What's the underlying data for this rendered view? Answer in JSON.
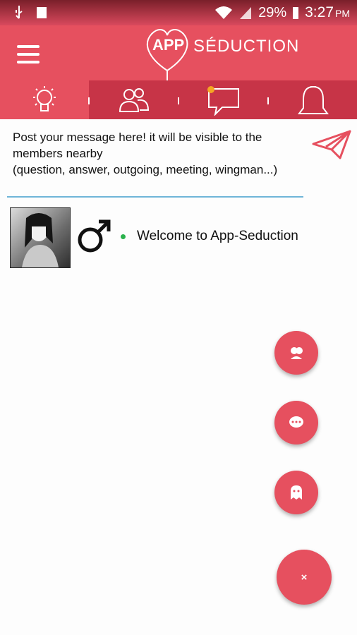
{
  "status_bar": {
    "battery": "29%",
    "time": "3:27",
    "ampm": "PM"
  },
  "header": {
    "logo_app": "APP",
    "logo_word": "SÉDUCTION"
  },
  "tabs": [
    {
      "icon": "lightbulb-icon",
      "active": true
    },
    {
      "icon": "people-icon",
      "active": false
    },
    {
      "icon": "chat-icon",
      "active": false,
      "badge": true
    },
    {
      "icon": "bell-icon",
      "active": false
    }
  ],
  "post": {
    "placeholder": "Post your message here! it will be visible to the members nearby\n(question, answer, outgoing, meeting, wingman...)"
  },
  "feed": [
    {
      "gender_icon": "male-icon",
      "online": true,
      "message": "Welcome to App-Seduction"
    }
  ],
  "fabs": {
    "close_label": "×"
  },
  "colors": {
    "primary": "#e6505f",
    "tabbar": "#c73447",
    "accent": "#f5a623"
  }
}
